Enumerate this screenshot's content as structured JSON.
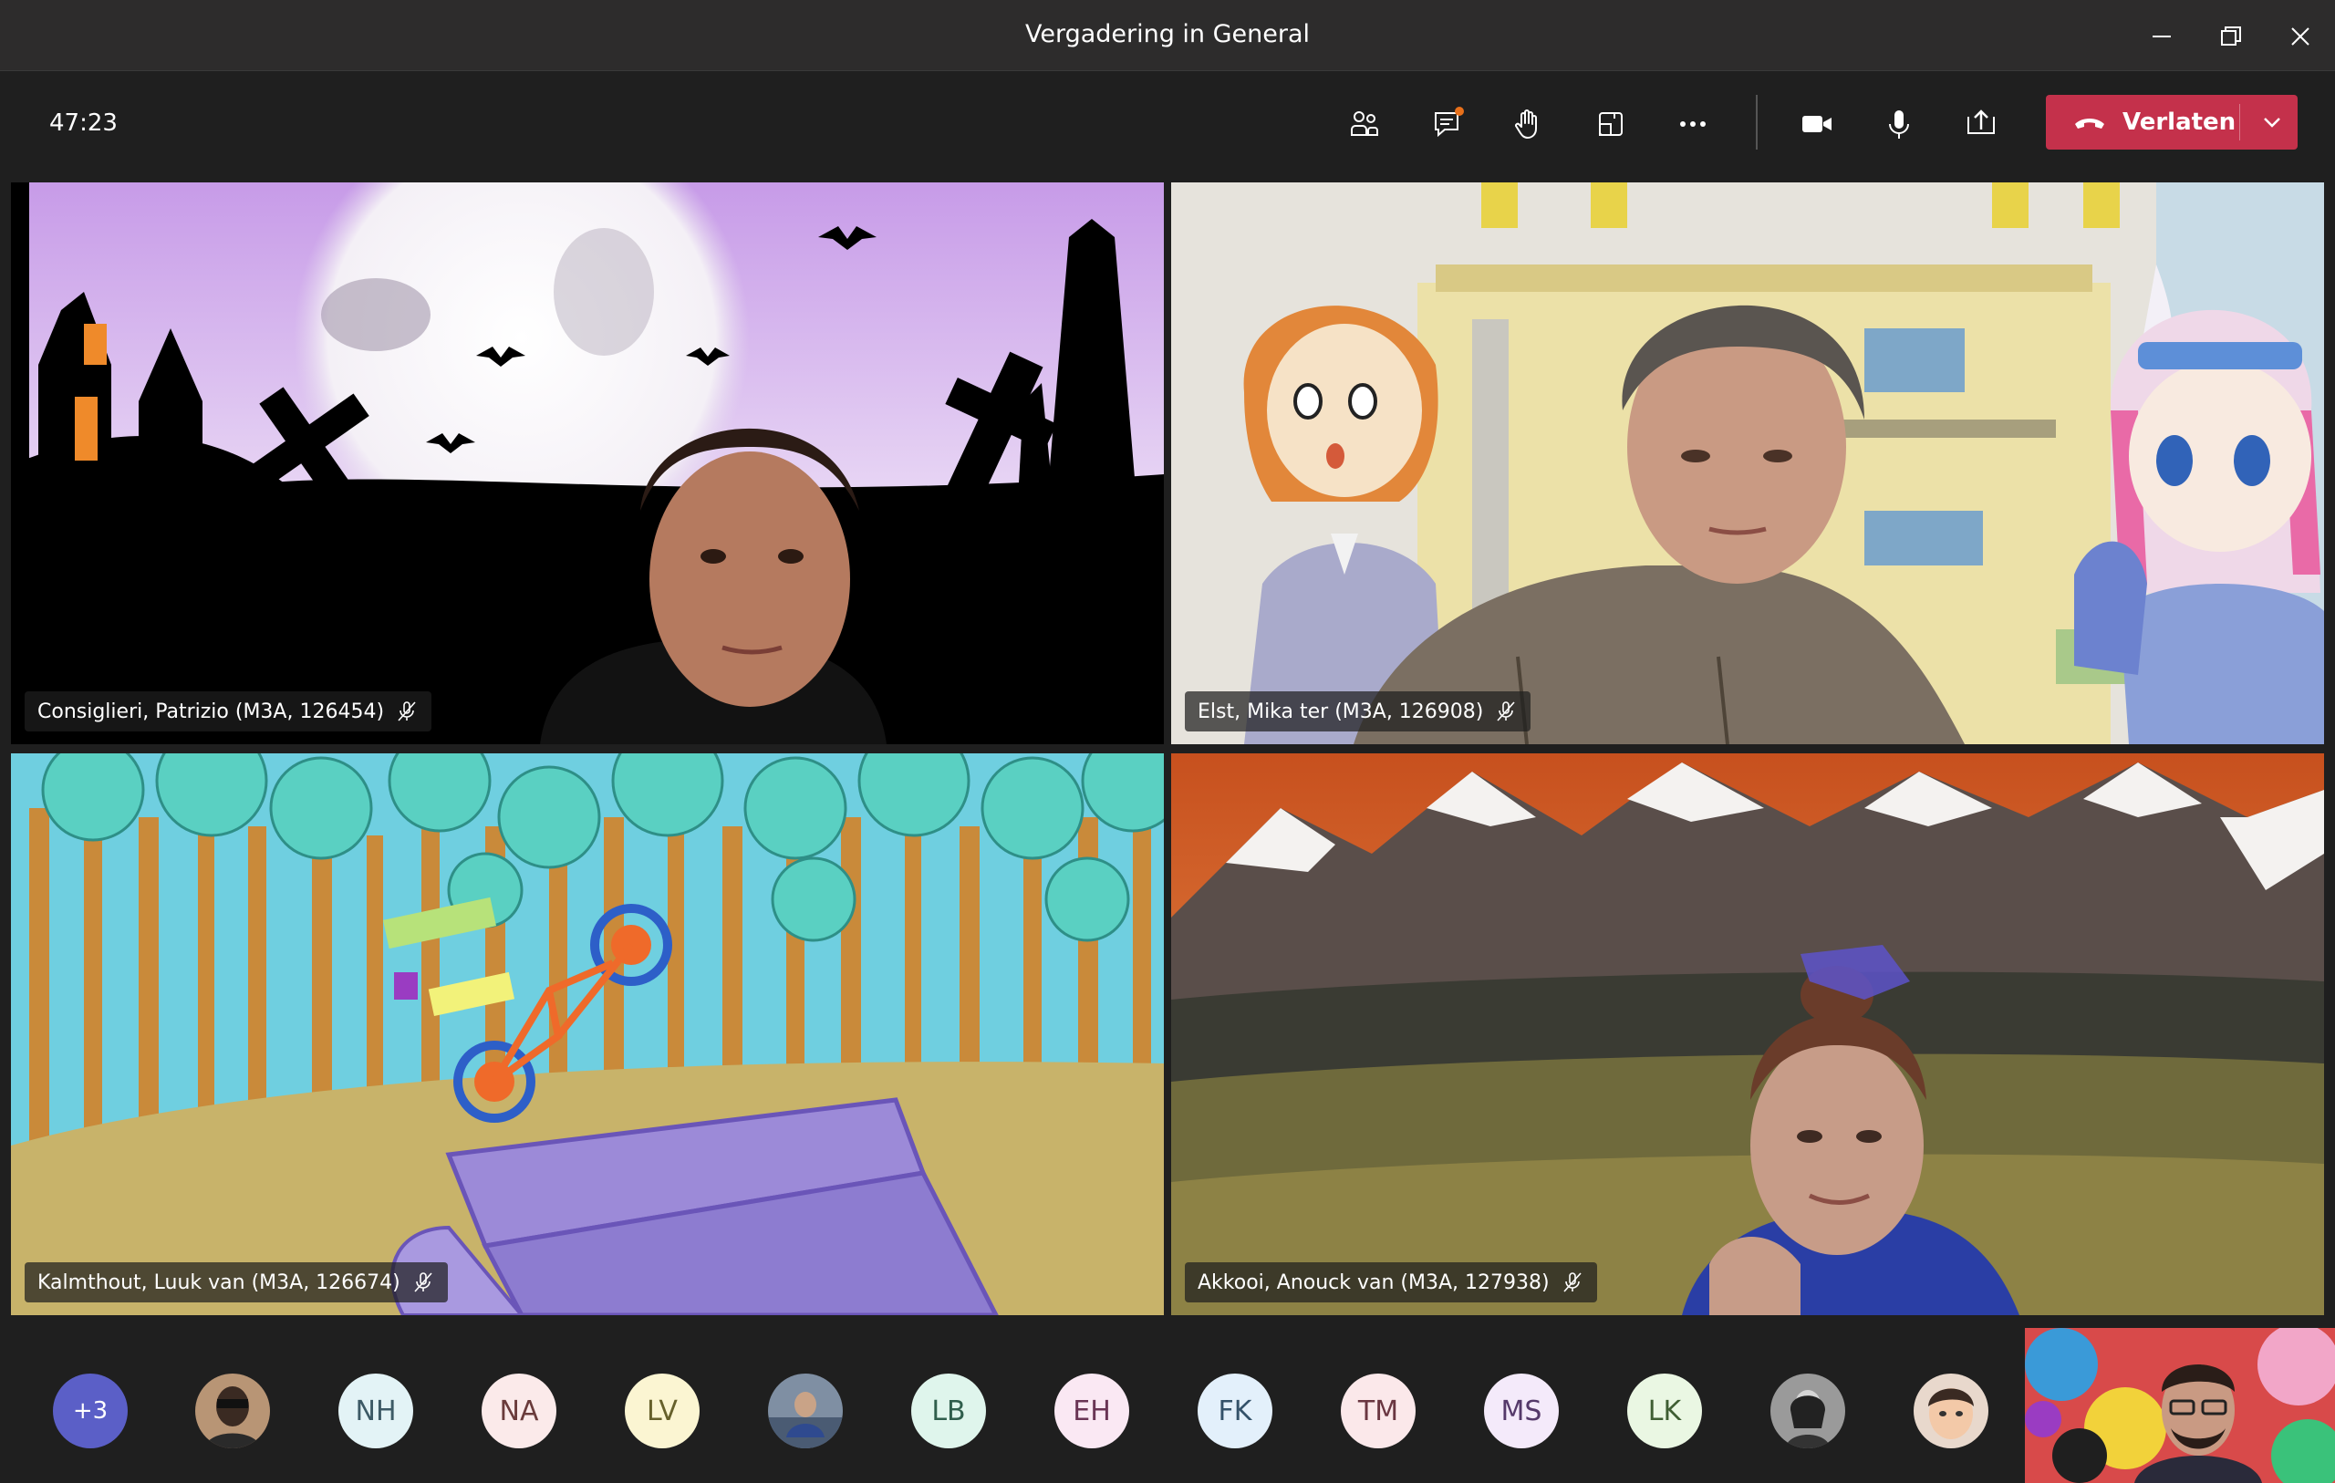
{
  "window": {
    "title": "Vergadering in General"
  },
  "toolbar": {
    "timer": "47:23",
    "leave_label": "Verlaten",
    "icons": [
      "participants-icon",
      "chat-icon",
      "raise-hand-icon",
      "breakout-rooms-icon",
      "more-options-icon",
      "camera-icon",
      "microphone-icon",
      "share-screen-icon"
    ],
    "leave_color": "#c4314b"
  },
  "participants": [
    {
      "name": "Consiglieri, Patrizio (M3A, 126454)",
      "muted": true
    },
    {
      "name": "Elst, Mika ter (M3A, 126908)",
      "muted": true
    },
    {
      "name": "Kalmthout, Luuk van (M3A, 126674)",
      "muted": true
    },
    {
      "name": "Akkooi, Anouck van (M3A, 127938)",
      "muted": true
    }
  ],
  "roster": {
    "overflow_label": "+3",
    "avatars": [
      {
        "initials": "",
        "type": "photo"
      },
      {
        "initials": "NH",
        "bg": "#e3f3f6",
        "fg": "#3d5a66"
      },
      {
        "initials": "NA",
        "bg": "#fbeaea",
        "fg": "#6a3b3b"
      },
      {
        "initials": "LV",
        "bg": "#fbf5d2",
        "fg": "#66602b"
      },
      {
        "initials": "",
        "type": "photo"
      },
      {
        "initials": "LB",
        "bg": "#dff5ec",
        "fg": "#2f5e4c"
      },
      {
        "initials": "EH",
        "bg": "#fae8f3",
        "fg": "#6a3555"
      },
      {
        "initials": "FK",
        "bg": "#e3f0fb",
        "fg": "#34526a"
      },
      {
        "initials": "TM",
        "bg": "#fbe8ea",
        "fg": "#6a3641"
      },
      {
        "initials": "MS",
        "bg": "#f4eafa",
        "fg": "#55396a"
      },
      {
        "initials": "LK",
        "bg": "#eaf7e3",
        "fg": "#3f5e33"
      },
      {
        "initials": "",
        "type": "photo"
      },
      {
        "initials": "",
        "type": "photo"
      }
    ]
  }
}
